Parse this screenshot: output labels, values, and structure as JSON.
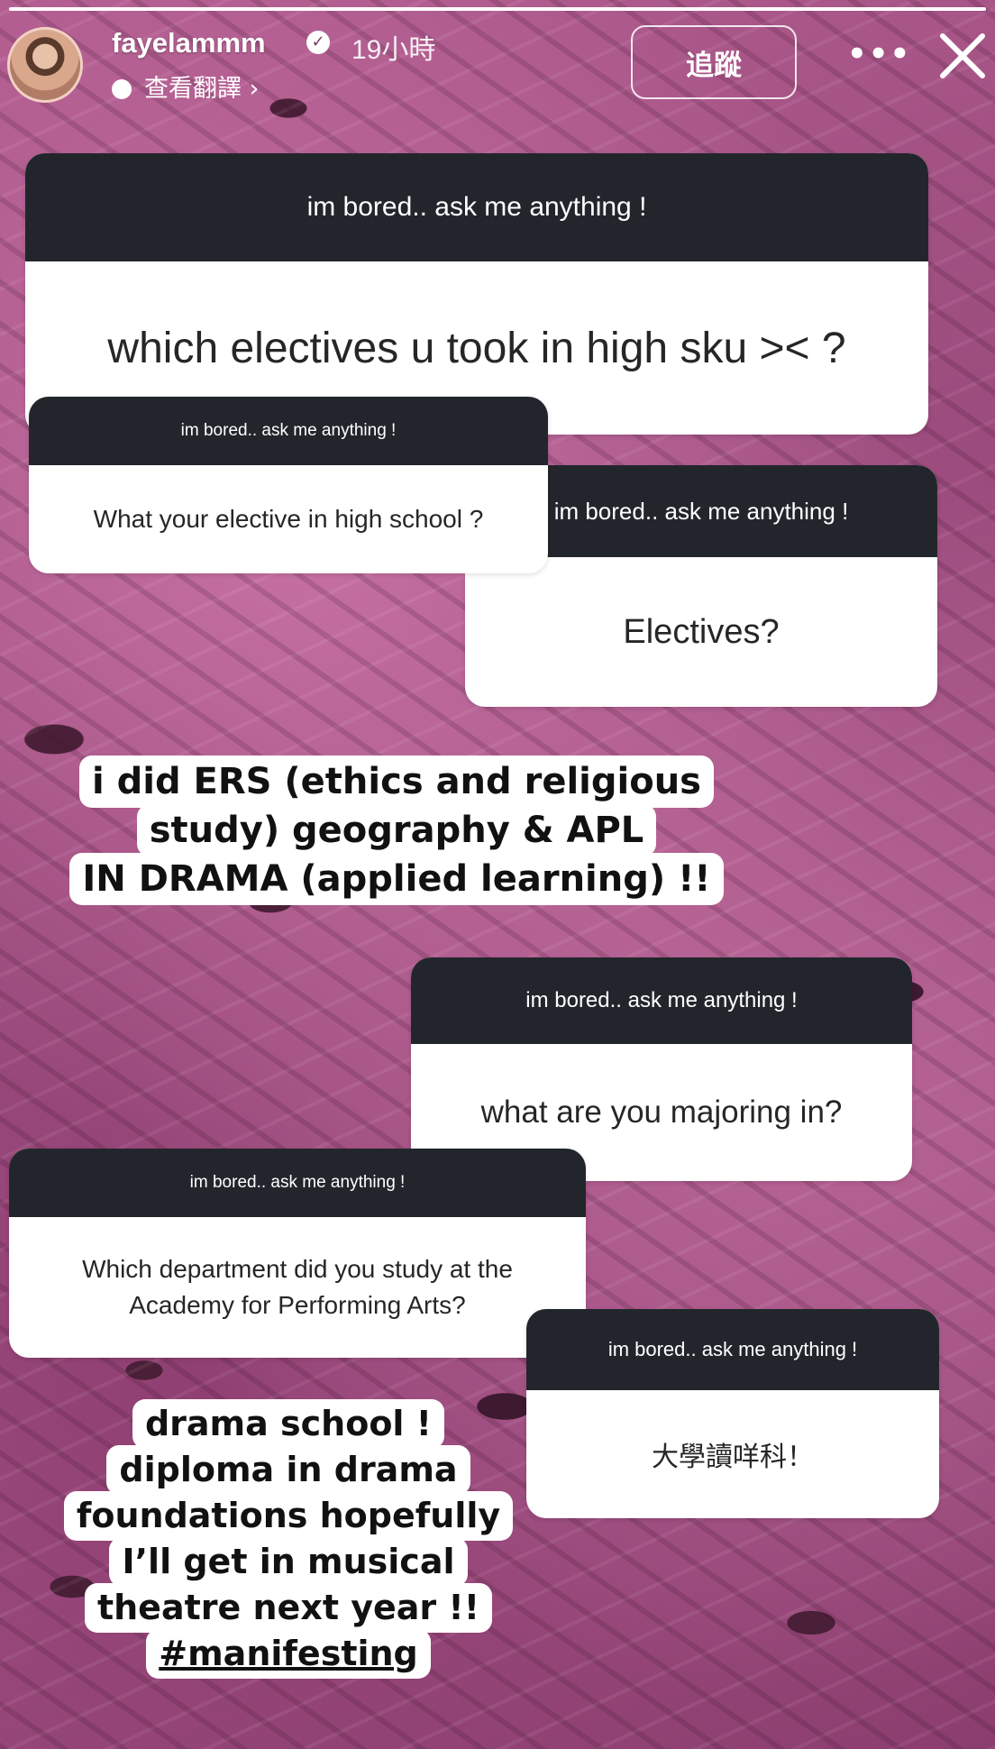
{
  "header": {
    "username": "fayelammm",
    "verified_mark": "✓",
    "time": "19小時",
    "translate_label": "查看翻譯 ›",
    "follow_label": "追蹤",
    "more_label": "•••"
  },
  "questions": [
    {
      "header": "im bored.. ask me anything !",
      "text": "which electives u took in high sku >< ?"
    },
    {
      "header": "im bored.. ask me anything !",
      "text": "What your elective in high school ?"
    },
    {
      "header": "im bored.. ask me anything !",
      "text": "Electives?"
    },
    {
      "header": "im bored.. ask me anything !",
      "text": "what are you majoring in?"
    },
    {
      "header": "im bored.. ask me anything !",
      "text": "Which department did you study at the Academy for Performing Arts?"
    },
    {
      "header": "im bored.. ask me anything !",
      "text": "大學讀咩科！"
    }
  ],
  "answers": [
    {
      "lines": [
        "i did ERS (ethics and religious",
        "study) geography & APL",
        "IN DRAMA (applied learning) !!"
      ]
    },
    {
      "lines": [
        "drama school !",
        "diploma in drama",
        "foundations hopefully",
        "I’ll get in musical",
        "theatre next year !!",
        "#manifesting"
      ]
    }
  ],
  "colors": {
    "question_header": "#22262c",
    "background": "#a24f84"
  },
  "icons": {
    "close": "close-icon",
    "more": "more-options-icon",
    "verified": "verified-badge-icon",
    "translate": "translate-icon"
  }
}
